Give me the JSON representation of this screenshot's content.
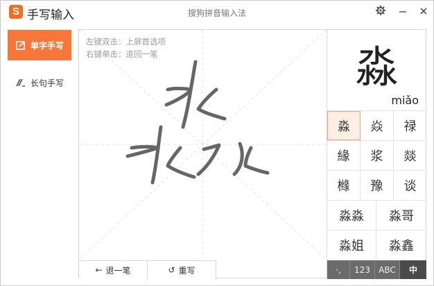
{
  "app": {
    "title": "手写输入",
    "logo_letter": "S",
    "window_title": "搜狗拼音输入法",
    "accent_color": "#f7763a"
  },
  "titlebar": {
    "settings_icon": "gear-icon",
    "minimize_icon": "minimize-icon",
    "close_icon": "close-icon"
  },
  "sidebar": {
    "items": [
      {
        "label": "单字手写",
        "icon": "single-char-icon",
        "active": true
      },
      {
        "label": "长句手写",
        "icon": "sentence-icon",
        "active": false
      }
    ]
  },
  "canvas": {
    "hint_double_click": "左键双击：上屏首选项",
    "hint_right_click": "右键单击：退回一笔",
    "undo_label": "退一笔",
    "rewrite_label": "重写"
  },
  "preview": {
    "character": "淼",
    "pinyin": "miǎo"
  },
  "candidates": {
    "row1": [
      "淼",
      "焱",
      "禄"
    ],
    "row2": [
      "緣",
      "浆",
      "燚"
    ],
    "row3": [
      "橼",
      "豫",
      "谈"
    ],
    "row4": [
      "淼淼",
      "淼哥"
    ],
    "row5": [
      "淼姐",
      "淼鑫"
    ]
  },
  "modes": {
    "punct": "·,",
    "numbers": "123",
    "letters": "ABC",
    "chinese": "中"
  }
}
